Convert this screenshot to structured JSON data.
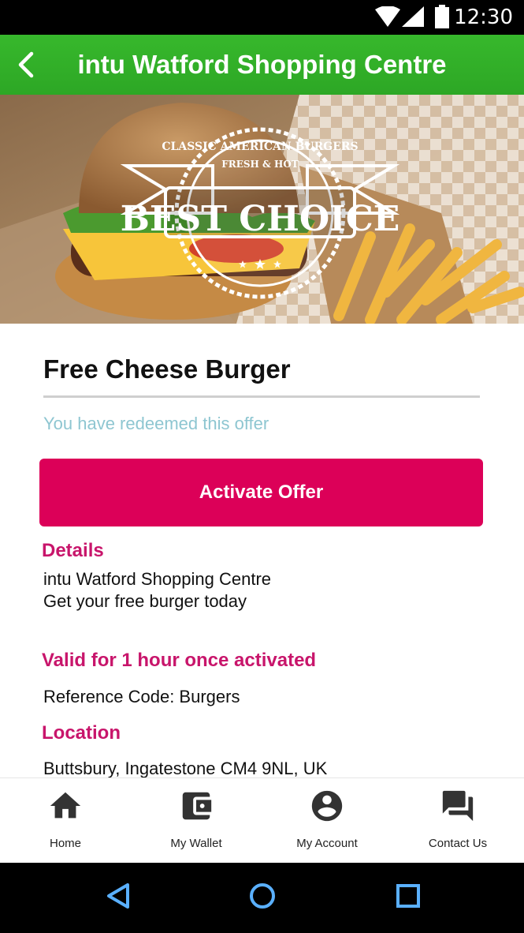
{
  "status_bar": {
    "time": "12:30"
  },
  "app_bar": {
    "title": "intu Watford Shopping Centre"
  },
  "hero": {
    "badge_top": "CLASSIC AMERICAN BURGERS",
    "badge_mid": "FRESH & HOT",
    "badge_main": "BEST CHOICE"
  },
  "offer": {
    "title": "Free Cheese Burger",
    "status": "You have redeemed this offer",
    "activate_label": "Activate Offer",
    "details_heading": "Details",
    "details_line1": "intu Watford Shopping Centre",
    "details_line2": "Get your free burger today",
    "validity": "Valid for 1 hour once activated",
    "reference": "Reference Code: Burgers",
    "location_heading": "Location",
    "address": "Buttsbury, Ingatestone CM4 9NL, UK"
  },
  "bottom_nav": {
    "items": [
      {
        "label": "Home",
        "icon": "home-icon"
      },
      {
        "label": "My Wallet",
        "icon": "wallet-icon"
      },
      {
        "label": "My Account",
        "icon": "account-icon"
      },
      {
        "label": "Contact Us",
        "icon": "chat-icon"
      }
    ]
  },
  "colors": {
    "app_bar": "#2da725",
    "accent": "#dc0058",
    "heading": "#c8156b",
    "redeemed_text": "#8ec6d1"
  }
}
